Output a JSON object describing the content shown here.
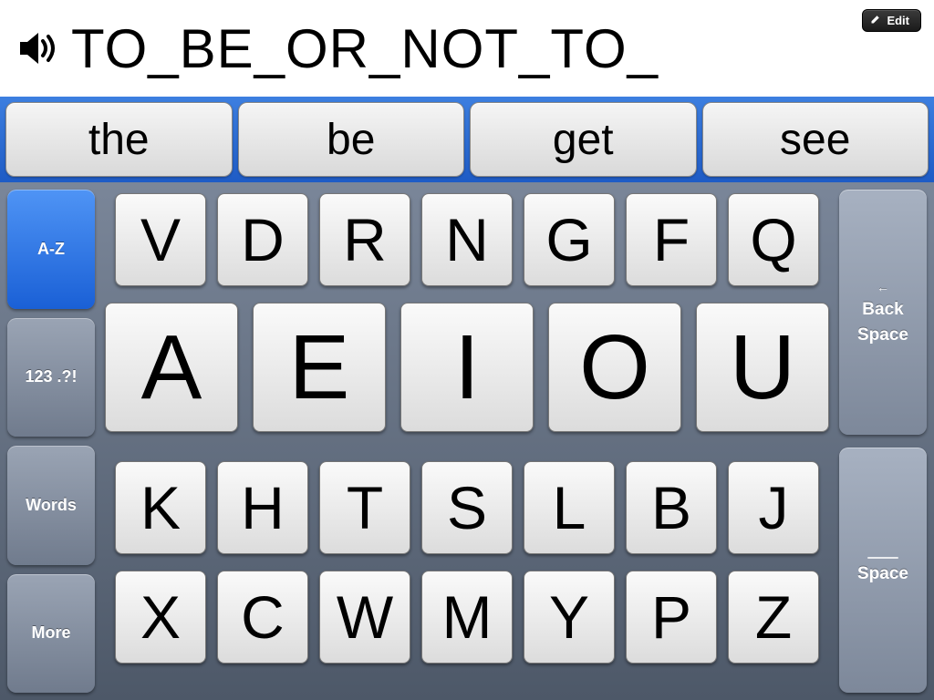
{
  "display": {
    "text": "TO_BE_OR_NOT_TO_"
  },
  "edit": {
    "label": "Edit"
  },
  "suggestions": [
    "the",
    "be",
    "get",
    "see"
  ],
  "left_modes": [
    {
      "label": "A-Z",
      "active": true
    },
    {
      "label": "123 .?!",
      "active": false
    },
    {
      "label": "Words",
      "active": false
    },
    {
      "label": "More",
      "active": false
    }
  ],
  "rows": {
    "r1": [
      "V",
      "D",
      "R",
      "N",
      "G",
      "F",
      "Q"
    ],
    "r2": [
      "A",
      "E",
      "I",
      "O",
      "U"
    ],
    "r3": [
      "K",
      "H",
      "T",
      "S",
      "L",
      "B",
      "J"
    ],
    "r4": [
      "X",
      "C",
      "W",
      "M",
      "Y",
      "P",
      "Z"
    ]
  },
  "actions": {
    "backspace": {
      "line1": "Back",
      "line2": "Space",
      "arrow": "←"
    },
    "space": {
      "label": "Space"
    }
  }
}
